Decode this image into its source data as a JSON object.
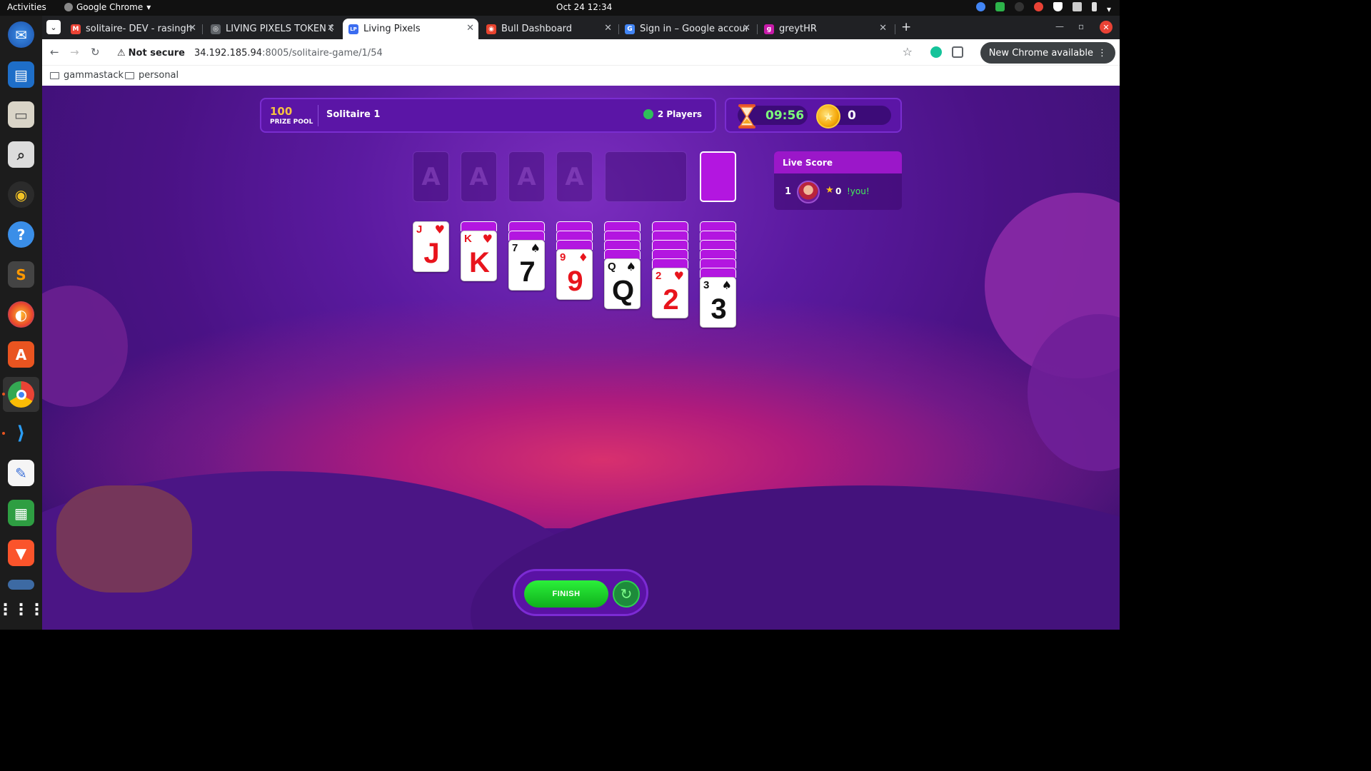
{
  "desktop": {
    "activities": "Activities",
    "app_name": "Google Chrome",
    "clock": "Oct 24  12:34",
    "dock_apps": [
      "thunderbird-icon",
      "writer-icon",
      "files-icon",
      "search-icon",
      "rhythmbox-icon",
      "help-icon",
      "sublime-icon",
      "firefox-icon",
      "appcenter-icon",
      "chrome-icon",
      "vscode-icon",
      "text-editor-icon",
      "calc-icon",
      "brave-icon",
      "remmina-icon",
      "show-apps-icon"
    ]
  },
  "browser": {
    "tabs": [
      {
        "label": "solitaire- DEV - rasingh@",
        "fav_color": "#ea4335",
        "fav_glyph": "M"
      },
      {
        "label": "LIVING PIXELS TOKEN G",
        "fav_color": "#5f6368",
        "fav_glyph": "◎"
      },
      {
        "label": "Living Pixels",
        "fav_color": "#3b6cf0",
        "fav_glyph": "LP"
      },
      {
        "label": "Bull Dashboard",
        "fav_color": "#e8432e",
        "fav_glyph": "◉"
      },
      {
        "label": "Sign in – Google account",
        "fav_color": "#4285f4",
        "fav_glyph": "G"
      },
      {
        "label": "greytHR",
        "fav_color": "#c71aa8",
        "fav_glyph": "g"
      }
    ],
    "not_secure": "Not secure",
    "url_host": "34.192.185.94",
    "url_path": ":8005/solitaire-game/1/54",
    "new_chrome": "New Chrome available",
    "profile_letter": "R",
    "bookmarks": [
      "gammastack",
      "personal"
    ]
  },
  "game": {
    "prize_value": "100",
    "prize_label": "PRIZE POOL",
    "title": "Solitaire 1",
    "players": "2 Players",
    "timer": "09:56",
    "coins": "0",
    "foundation_placeholder": "A",
    "tableau": [
      {
        "down": 0,
        "rank": "J",
        "suit": "♥",
        "color": "red"
      },
      {
        "down": 1,
        "rank": "K",
        "suit": "♥",
        "color": "red"
      },
      {
        "down": 2,
        "rank": "7",
        "suit": "♠",
        "color": "black"
      },
      {
        "down": 3,
        "rank": "9",
        "suit": "♦",
        "color": "red"
      },
      {
        "down": 4,
        "rank": "Q",
        "suit": "♠",
        "color": "black"
      },
      {
        "down": 5,
        "rank": "2",
        "suit": "♥",
        "color": "red"
      },
      {
        "down": 6,
        "rank": "3",
        "suit": "♠",
        "color": "black"
      }
    ],
    "live_score": {
      "title": "Live Score",
      "rank": "1",
      "points": "0",
      "player": "!you!"
    },
    "finish_label": "FINISH",
    "undo_icon": "↻"
  }
}
